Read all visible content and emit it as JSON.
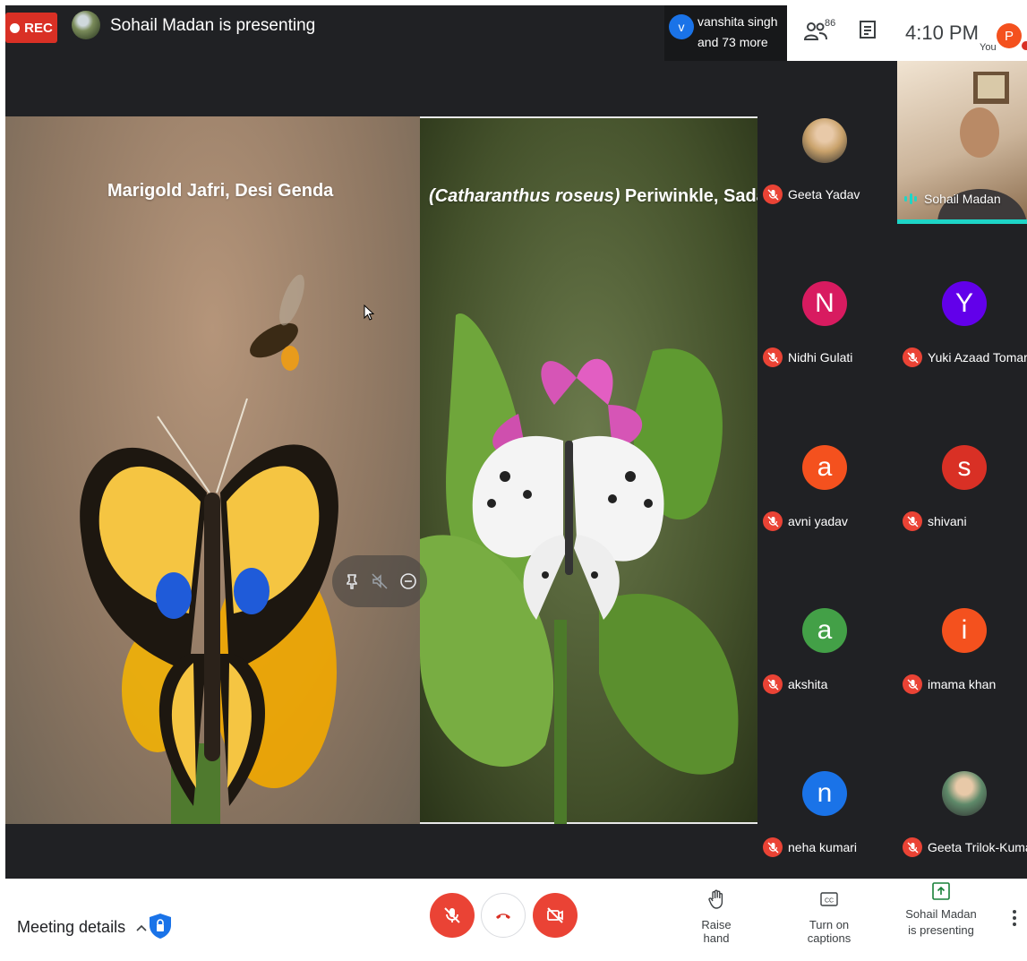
{
  "top_bar": {
    "rec_label": "REC",
    "presenting_text": "Sohail Madan is presenting",
    "overflow_name": "vanshita singh",
    "overflow_more": "and 73 more",
    "overflow_initial": "v",
    "people_count": "86",
    "clock": "4:10 PM",
    "self_label": "You",
    "self_initial": "P"
  },
  "presentation": {
    "left_caption": "Marigold Jafri, Desi Genda",
    "right_caption_italic": "(Catharanthus roseus)",
    "right_caption_rest": " Periwinkle, Sadabahar"
  },
  "participants": [
    {
      "name": "Geeta Yadav",
      "avatar": "photo",
      "color": "#c9a26b"
    },
    {
      "name": "Sohail Madan",
      "avatar": "video",
      "color": "#1ed5c7"
    },
    {
      "name": "Nidhi Gulati",
      "avatar": "N",
      "color": "#d81b60"
    },
    {
      "name": "Yuki Azaad Tomar",
      "avatar": "Y",
      "color": "#6200ea"
    },
    {
      "name": "avni yadav",
      "avatar": "a",
      "color": "#f4511e"
    },
    {
      "name": "shivani",
      "avatar": "s",
      "color": "#d93025"
    },
    {
      "name": "akshita",
      "avatar": "a",
      "color": "#43a047"
    },
    {
      "name": "imama khan",
      "avatar": "i",
      "color": "#f4511e"
    },
    {
      "name": "neha kumari",
      "avatar": "n",
      "color": "#1a73e8"
    },
    {
      "name": "Geeta Trilok-Kumar",
      "avatar": "photo",
      "color": "#5f8a6a"
    }
  ],
  "bottom_bar": {
    "meeting_details": "Meeting details",
    "raise_hand": "Raise hand",
    "captions": "Turn on captions",
    "present_line1": "Sohail Madan",
    "present_line2": "is presenting"
  },
  "colors": {
    "danger": "#ea4335",
    "speaking": "#1ed5c7",
    "accent": "#1a73e8"
  }
}
